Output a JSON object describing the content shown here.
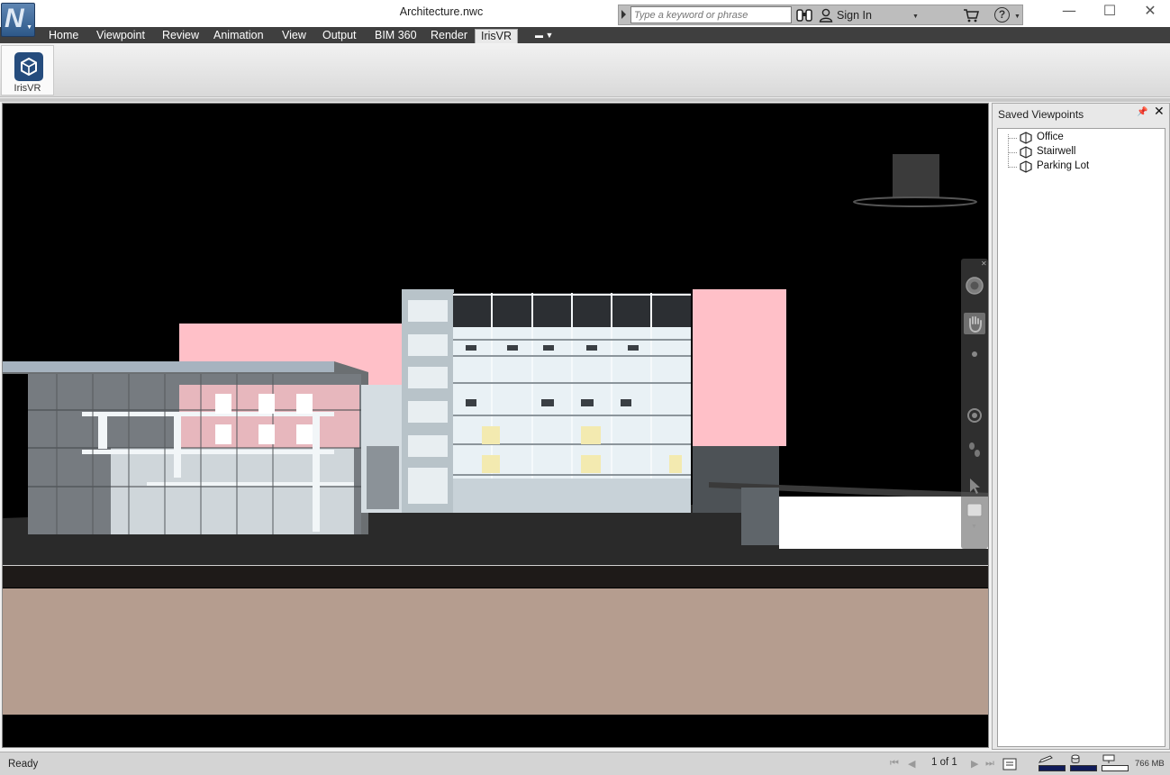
{
  "app": {
    "logo_letter": "N",
    "document_title": "Architecture.nwc"
  },
  "search": {
    "placeholder": "Type a keyword or phrase",
    "value": ""
  },
  "account": {
    "sign_in_label": "Sign In"
  },
  "help": {
    "label": "?"
  },
  "window_controls": {
    "minimize": "—",
    "maximize": "☐",
    "close": "✕"
  },
  "ribbon": {
    "tabs": [
      {
        "label": "Home"
      },
      {
        "label": "Viewpoint"
      },
      {
        "label": "Review"
      },
      {
        "label": "Animation"
      },
      {
        "label": "View"
      },
      {
        "label": "Output"
      },
      {
        "label": "BIM 360"
      },
      {
        "label": "Render"
      },
      {
        "label": "IrisVR"
      }
    ],
    "active_tab": "IrisVR",
    "buttons": {
      "irisvr_label": "IrisVR"
    }
  },
  "saved_viewpoints": {
    "title": "Saved Viewpoints",
    "items": [
      {
        "label": "Office"
      },
      {
        "label": "Stairwell"
      },
      {
        "label": "Parking Lot"
      }
    ]
  },
  "status": {
    "text": "Ready",
    "page_indicator": "1 of 1",
    "memory": "766 MB",
    "pencil_meter": 1.0,
    "disk_meter": 1.0,
    "network_meter": 0.0
  },
  "colors": {
    "accent_pink": "#ffc0c8",
    "navbar": "#555555",
    "ground": "#b59d8f",
    "irisvr_brand": "#254c7d"
  }
}
